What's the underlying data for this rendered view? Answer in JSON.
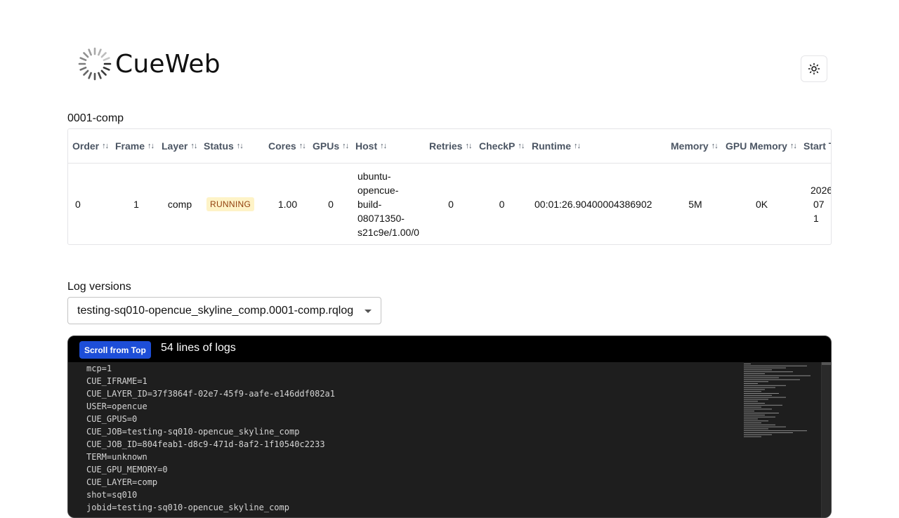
{
  "app": {
    "name": "CueWeb"
  },
  "theme_toggle": {
    "icon": "sun-icon"
  },
  "frame_table": {
    "title": "0001-comp",
    "columns": [
      "Order",
      "Frame",
      "Layer",
      "Status",
      "Cores",
      "GPUs",
      "Host",
      "Retries",
      "CheckP",
      "Runtime",
      "Memory",
      "GPU Memory",
      "Start T"
    ],
    "rows": [
      {
        "order": "0",
        "frame": "1",
        "layer": "comp",
        "status": "RUNNING",
        "cores": "1.00",
        "gpus": "0",
        "host": "ubuntu-opencue-build-08071350-s21c9e/1.00/0",
        "host_lines": [
          "ubuntu-",
          "opencue-",
          "build-",
          "08071350-",
          "s21c9e/1.00/0"
        ],
        "retries": "0",
        "checkp": "0",
        "runtime": "00:01:26.90400004386902",
        "memory": "5M",
        "gpu_memory": "0K",
        "start_time_lines": [
          "2026",
          "07 1"
        ]
      }
    ]
  },
  "log_versions": {
    "label": "Log versions",
    "selected": "testing-sq010-opencue_skyline_comp.0001-comp.rqlog"
  },
  "log_viewer": {
    "scroll_button": "Scroll from Top",
    "line_count_text": "54 lines of logs",
    "lines": [
      "mcp=1",
      "CUE_IFRAME=1",
      "CUE_LAYER_ID=37f3864f-02e7-45f9-aafe-e146ddf082a1",
      "USER=opencue",
      "CUE_GPUS=0",
      "CUE_JOB=testing-sq010-opencue_skyline_comp",
      "CUE_JOB_ID=804feab1-d8c9-471d-8af2-1f10540c2233",
      "TERM=unknown",
      "CUE_GPU_MEMORY=0",
      "CUE_LAYER=comp",
      "shot=sq010",
      "jobid=testing-sq010-opencue_skyline_comp"
    ]
  },
  "colors": {
    "running_badge_bg": "#fef3c7",
    "running_badge_text": "#92400e",
    "scroll_button_bg": "#1d4ed8",
    "log_bg": "#1e1e1e"
  }
}
